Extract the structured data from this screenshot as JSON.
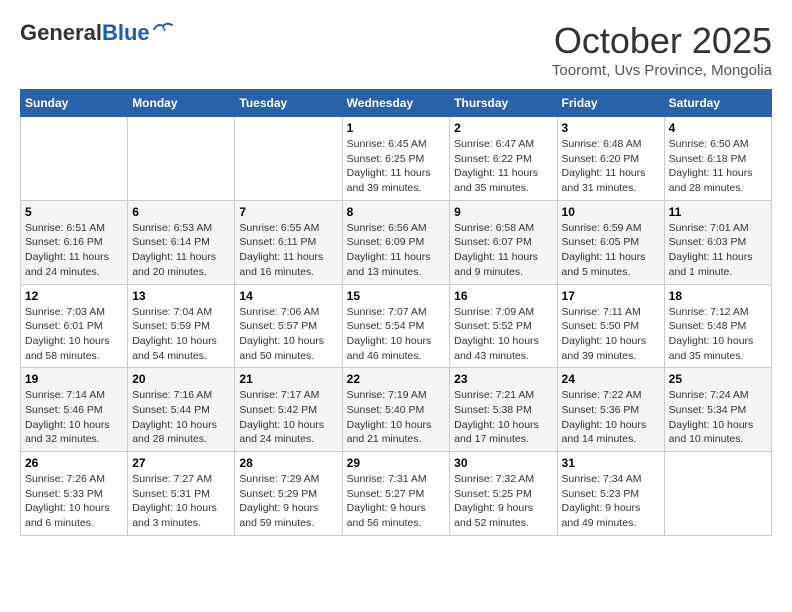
{
  "header": {
    "logo_general": "General",
    "logo_blue": "Blue",
    "month_year": "October 2025",
    "location": "Tooromt, Uvs Province, Mongolia"
  },
  "days_of_week": [
    "Sunday",
    "Monday",
    "Tuesday",
    "Wednesday",
    "Thursday",
    "Friday",
    "Saturday"
  ],
  "weeks": [
    [
      {
        "day": "",
        "info": ""
      },
      {
        "day": "",
        "info": ""
      },
      {
        "day": "",
        "info": ""
      },
      {
        "day": "1",
        "info": "Sunrise: 6:45 AM\nSunset: 6:25 PM\nDaylight: 11 hours\nand 39 minutes."
      },
      {
        "day": "2",
        "info": "Sunrise: 6:47 AM\nSunset: 6:22 PM\nDaylight: 11 hours\nand 35 minutes."
      },
      {
        "day": "3",
        "info": "Sunrise: 6:48 AM\nSunset: 6:20 PM\nDaylight: 11 hours\nand 31 minutes."
      },
      {
        "day": "4",
        "info": "Sunrise: 6:50 AM\nSunset: 6:18 PM\nDaylight: 11 hours\nand 28 minutes."
      }
    ],
    [
      {
        "day": "5",
        "info": "Sunrise: 6:51 AM\nSunset: 6:16 PM\nDaylight: 11 hours\nand 24 minutes."
      },
      {
        "day": "6",
        "info": "Sunrise: 6:53 AM\nSunset: 6:14 PM\nDaylight: 11 hours\nand 20 minutes."
      },
      {
        "day": "7",
        "info": "Sunrise: 6:55 AM\nSunset: 6:11 PM\nDaylight: 11 hours\nand 16 minutes."
      },
      {
        "day": "8",
        "info": "Sunrise: 6:56 AM\nSunset: 6:09 PM\nDaylight: 11 hours\nand 13 minutes."
      },
      {
        "day": "9",
        "info": "Sunrise: 6:58 AM\nSunset: 6:07 PM\nDaylight: 11 hours\nand 9 minutes."
      },
      {
        "day": "10",
        "info": "Sunrise: 6:59 AM\nSunset: 6:05 PM\nDaylight: 11 hours\nand 5 minutes."
      },
      {
        "day": "11",
        "info": "Sunrise: 7:01 AM\nSunset: 6:03 PM\nDaylight: 11 hours\nand 1 minute."
      }
    ],
    [
      {
        "day": "12",
        "info": "Sunrise: 7:03 AM\nSunset: 6:01 PM\nDaylight: 10 hours\nand 58 minutes."
      },
      {
        "day": "13",
        "info": "Sunrise: 7:04 AM\nSunset: 5:59 PM\nDaylight: 10 hours\nand 54 minutes."
      },
      {
        "day": "14",
        "info": "Sunrise: 7:06 AM\nSunset: 5:57 PM\nDaylight: 10 hours\nand 50 minutes."
      },
      {
        "day": "15",
        "info": "Sunrise: 7:07 AM\nSunset: 5:54 PM\nDaylight: 10 hours\nand 46 minutes."
      },
      {
        "day": "16",
        "info": "Sunrise: 7:09 AM\nSunset: 5:52 PM\nDaylight: 10 hours\nand 43 minutes."
      },
      {
        "day": "17",
        "info": "Sunrise: 7:11 AM\nSunset: 5:50 PM\nDaylight: 10 hours\nand 39 minutes."
      },
      {
        "day": "18",
        "info": "Sunrise: 7:12 AM\nSunset: 5:48 PM\nDaylight: 10 hours\nand 35 minutes."
      }
    ],
    [
      {
        "day": "19",
        "info": "Sunrise: 7:14 AM\nSunset: 5:46 PM\nDaylight: 10 hours\nand 32 minutes."
      },
      {
        "day": "20",
        "info": "Sunrise: 7:16 AM\nSunset: 5:44 PM\nDaylight: 10 hours\nand 28 minutes."
      },
      {
        "day": "21",
        "info": "Sunrise: 7:17 AM\nSunset: 5:42 PM\nDaylight: 10 hours\nand 24 minutes."
      },
      {
        "day": "22",
        "info": "Sunrise: 7:19 AM\nSunset: 5:40 PM\nDaylight: 10 hours\nand 21 minutes."
      },
      {
        "day": "23",
        "info": "Sunrise: 7:21 AM\nSunset: 5:38 PM\nDaylight: 10 hours\nand 17 minutes."
      },
      {
        "day": "24",
        "info": "Sunrise: 7:22 AM\nSunset: 5:36 PM\nDaylight: 10 hours\nand 14 minutes."
      },
      {
        "day": "25",
        "info": "Sunrise: 7:24 AM\nSunset: 5:34 PM\nDaylight: 10 hours\nand 10 minutes."
      }
    ],
    [
      {
        "day": "26",
        "info": "Sunrise: 7:26 AM\nSunset: 5:33 PM\nDaylight: 10 hours\nand 6 minutes."
      },
      {
        "day": "27",
        "info": "Sunrise: 7:27 AM\nSunset: 5:31 PM\nDaylight: 10 hours\nand 3 minutes."
      },
      {
        "day": "28",
        "info": "Sunrise: 7:29 AM\nSunset: 5:29 PM\nDaylight: 9 hours\nand 59 minutes."
      },
      {
        "day": "29",
        "info": "Sunrise: 7:31 AM\nSunset: 5:27 PM\nDaylight: 9 hours\nand 56 minutes."
      },
      {
        "day": "30",
        "info": "Sunrise: 7:32 AM\nSunset: 5:25 PM\nDaylight: 9 hours\nand 52 minutes."
      },
      {
        "day": "31",
        "info": "Sunrise: 7:34 AM\nSunset: 5:23 PM\nDaylight: 9 hours\nand 49 minutes."
      },
      {
        "day": "",
        "info": ""
      }
    ]
  ]
}
